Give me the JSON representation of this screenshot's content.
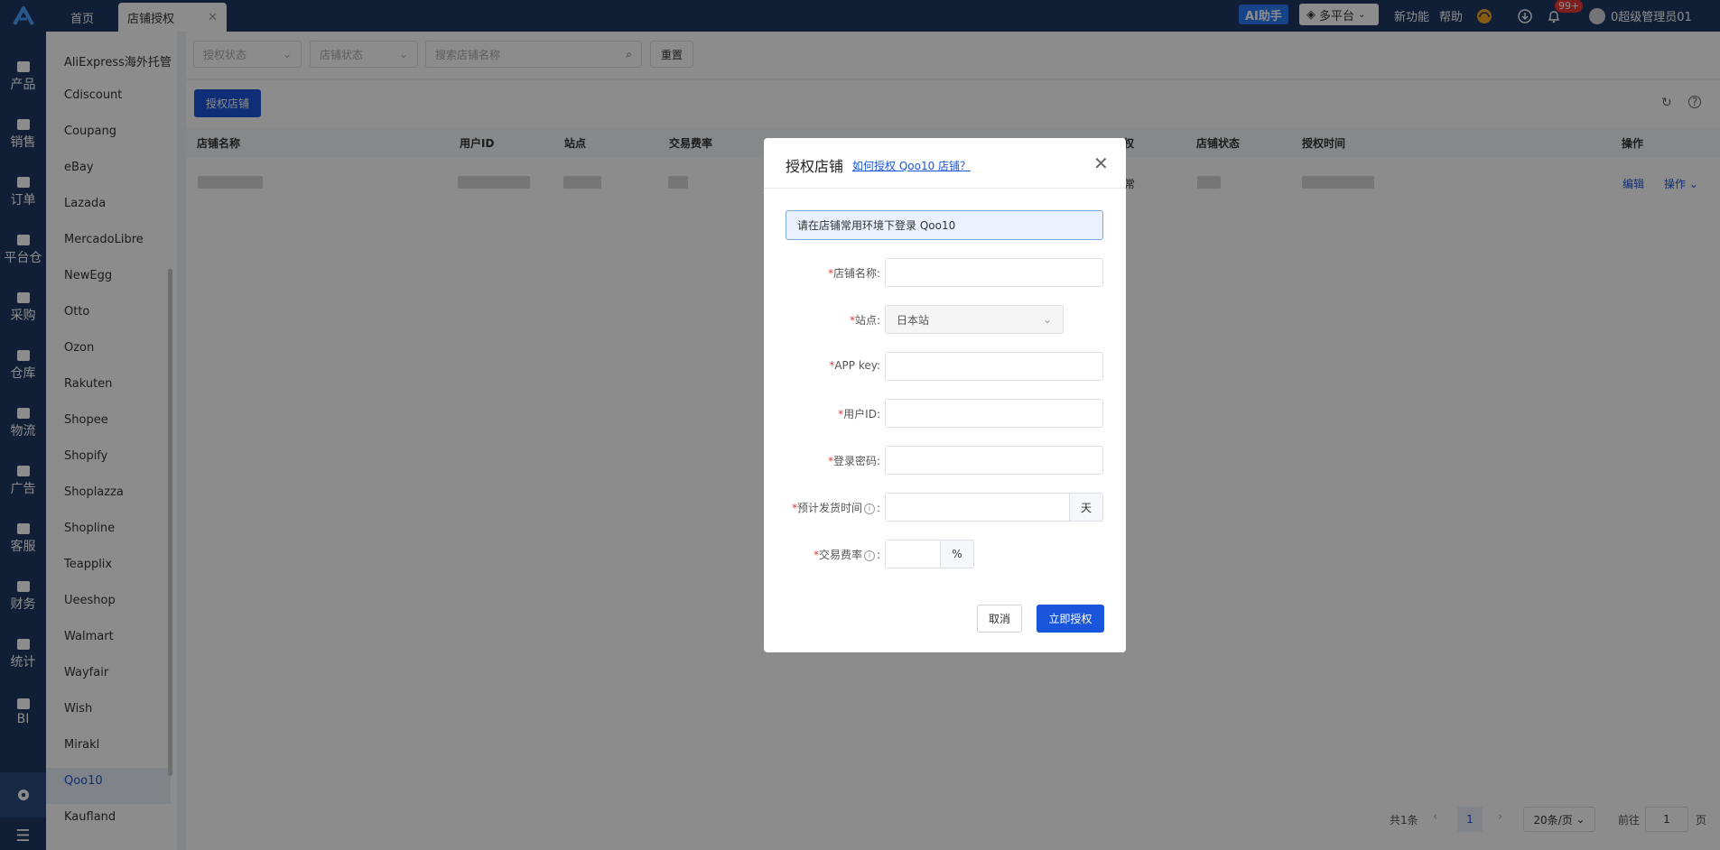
{
  "topbar": {
    "tabs": [
      {
        "label": "首页"
      },
      {
        "label": "店铺授权"
      }
    ],
    "ai_label": "AI助手",
    "platform_label": "多平台",
    "new_feature_label": "新功能",
    "help_label": "帮助",
    "notification_count": "99+",
    "user_label": "0超级管理员01"
  },
  "rail": {
    "items": [
      {
        "label": "产品",
        "icon": "box-icon"
      },
      {
        "label": "销售",
        "icon": "sell-icon"
      },
      {
        "label": "订单",
        "icon": "order-icon"
      },
      {
        "label": "平台仓",
        "icon": "warehouse-icon"
      },
      {
        "label": "采购",
        "icon": "cart-icon"
      },
      {
        "label": "仓库",
        "icon": "storage-icon"
      },
      {
        "label": "物流",
        "icon": "truck-icon"
      },
      {
        "label": "广告",
        "icon": "ad-icon"
      },
      {
        "label": "客服",
        "icon": "mail-icon"
      },
      {
        "label": "财务",
        "icon": "finance-icon"
      },
      {
        "label": "统计",
        "icon": "pie-icon"
      },
      {
        "label": "BI",
        "icon": "bi-icon"
      }
    ]
  },
  "platforms": {
    "items": [
      "AliExpress海外托管",
      "Cdiscount",
      "Coupang",
      "eBay",
      "Lazada",
      "MercadoLibre",
      "NewEgg",
      "Otto",
      "Ozon",
      "Rakuten",
      "Shopee",
      "Shopify",
      "Shoplazza",
      "Shopline",
      "Teapplix",
      "Ueeshop",
      "Walmart",
      "Wayfair",
      "Wish",
      "Mirakl",
      "Qoo10",
      "Kaufland"
    ],
    "active": "Qoo10"
  },
  "filters": {
    "auth_status_placeholder": "授权状态",
    "shop_status_placeholder": "店铺状态",
    "search_placeholder": "搜索店铺名称",
    "reset_label": "重置"
  },
  "toolbar": {
    "auth_shop_label": "授权店铺"
  },
  "table": {
    "columns": [
      "店铺名称",
      "用户ID",
      "站点",
      "交易费率",
      "权",
      "店铺状态",
      "授权时间",
      "操作"
    ],
    "rows": [
      {
        "status_fragment": "常",
        "edit_label": "编辑",
        "action_label": "操作"
      }
    ]
  },
  "pagination": {
    "total": "共1条",
    "current_page": "1",
    "page_size": "20条/页",
    "goto_label": "前往",
    "goto_value": "1",
    "page_suffix": "页"
  },
  "modal": {
    "title": "授权店铺",
    "help_link": "如何授权 Qoo10 店铺？",
    "notice": "请在店铺常用环境下登录 Qoo10",
    "fields": {
      "shop_name": {
        "label": "店铺名称:"
      },
      "site": {
        "label": "站点:",
        "value": "日本站"
      },
      "app_key": {
        "label": "APP key:"
      },
      "user_id": {
        "label": "用户ID:"
      },
      "password": {
        "label": "登录密码:"
      },
      "ship_time": {
        "label": "预计发货时间",
        "suffix": "天"
      },
      "fee_rate": {
        "label": "交易费率",
        "suffix": "%"
      }
    },
    "cancel_label": "取消",
    "confirm_label": "立即授权"
  },
  "colors": {
    "nav_bg": "#1f3a63",
    "primary": "#1a56db",
    "badge": "#e53935"
  }
}
